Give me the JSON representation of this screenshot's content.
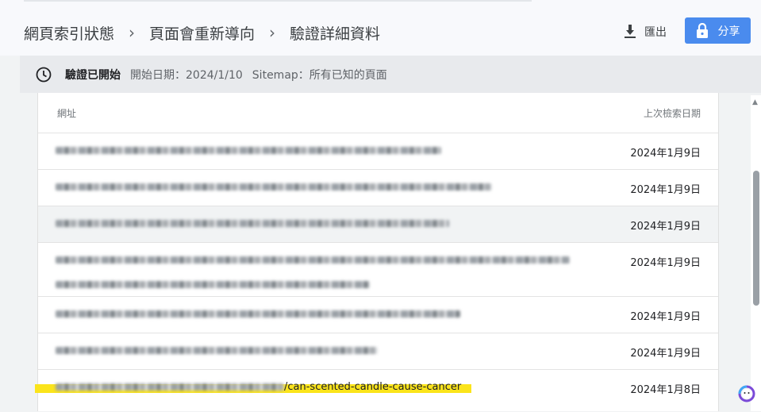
{
  "breadcrumb": [
    "網頁索引狀態",
    "頁面會重新導向",
    "驗證詳細資料"
  ],
  "toolbar": {
    "export_label": "匯出",
    "share_label": "分享"
  },
  "status": {
    "title": "驗證已開始",
    "start_date": "開始日期：2024/1/10",
    "sitemap": "Sitemap：所有已知的頁面"
  },
  "table": {
    "headers": {
      "url": "網址",
      "last_crawled": "上次檢索日期"
    },
    "rows": [
      {
        "url": "",
        "date": "2024年1月9日"
      },
      {
        "url": "",
        "date": "2024年1月9日"
      },
      {
        "url": "",
        "date": "2024年1月9日"
      },
      {
        "url": "",
        "date": "2024年1月9日"
      },
      {
        "url": "",
        "date": "2024年1月9日"
      },
      {
        "url": "",
        "date": "2024年1月9日"
      },
      {
        "url": "/can-scented-candle-cause-cancer",
        "date": "2024年1月8日"
      }
    ]
  },
  "icons": {
    "clock": "clock-icon",
    "download": "download-icon",
    "lock": "lock-icon",
    "assistant": "assistant-icon"
  },
  "colors": {
    "share_button": "#4a8bee",
    "highlight": "#fbe41b"
  }
}
